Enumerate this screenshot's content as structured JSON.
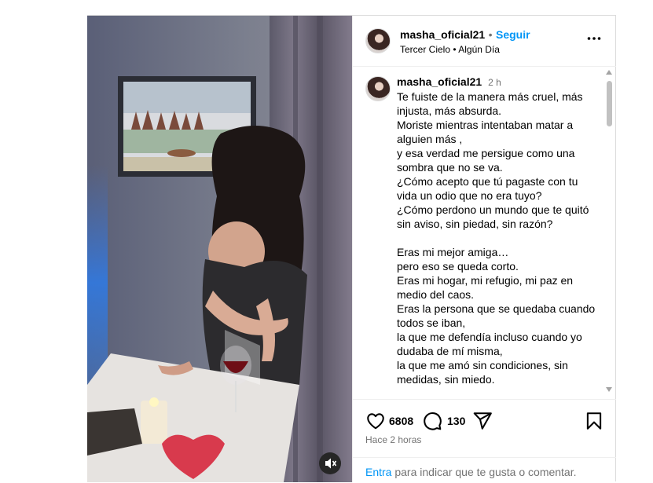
{
  "post": {
    "username": "masha_oficial21",
    "separator": "•",
    "follow_label": "Seguir",
    "audio": "Tercer Cielo • Algún Día",
    "more_icon": "more-options-icon",
    "caption": {
      "username": "masha_oficial21",
      "time": "2 h",
      "text": "Te fuiste de la manera más cruel, más injusta, más absurda.\nMoriste mientras intentaban matar a alguien más ,\ny esa verdad me persigue como una sombra que no se va.\n¿Cómo acepto que tú pagaste con tu vida un odio que no era tuyo?\n¿Cómo perdono un mundo que te quitó sin aviso, sin piedad, sin razón?\n\nEras mi mejor amiga…\npero eso se queda corto.\nEras mi hogar, mi refugio, mi paz en medio del caos.\nEras la persona que se quedaba cuando todos se iban,\nla que me defendía incluso cuando yo dudaba de mí misma,\nla que me amó sin condiciones, sin medidas, sin miedo."
    },
    "likes": "6808",
    "comments": "130",
    "posted_ago": "Hace 2 horas",
    "login_prompt": {
      "link": "Entra",
      "rest": " para indicar que te gusta o comentar."
    },
    "icons": {
      "like": "heart-icon",
      "comment": "comment-icon",
      "share": "share-icon",
      "save": "bookmark-icon",
      "mute": "muted-speaker-icon"
    }
  }
}
